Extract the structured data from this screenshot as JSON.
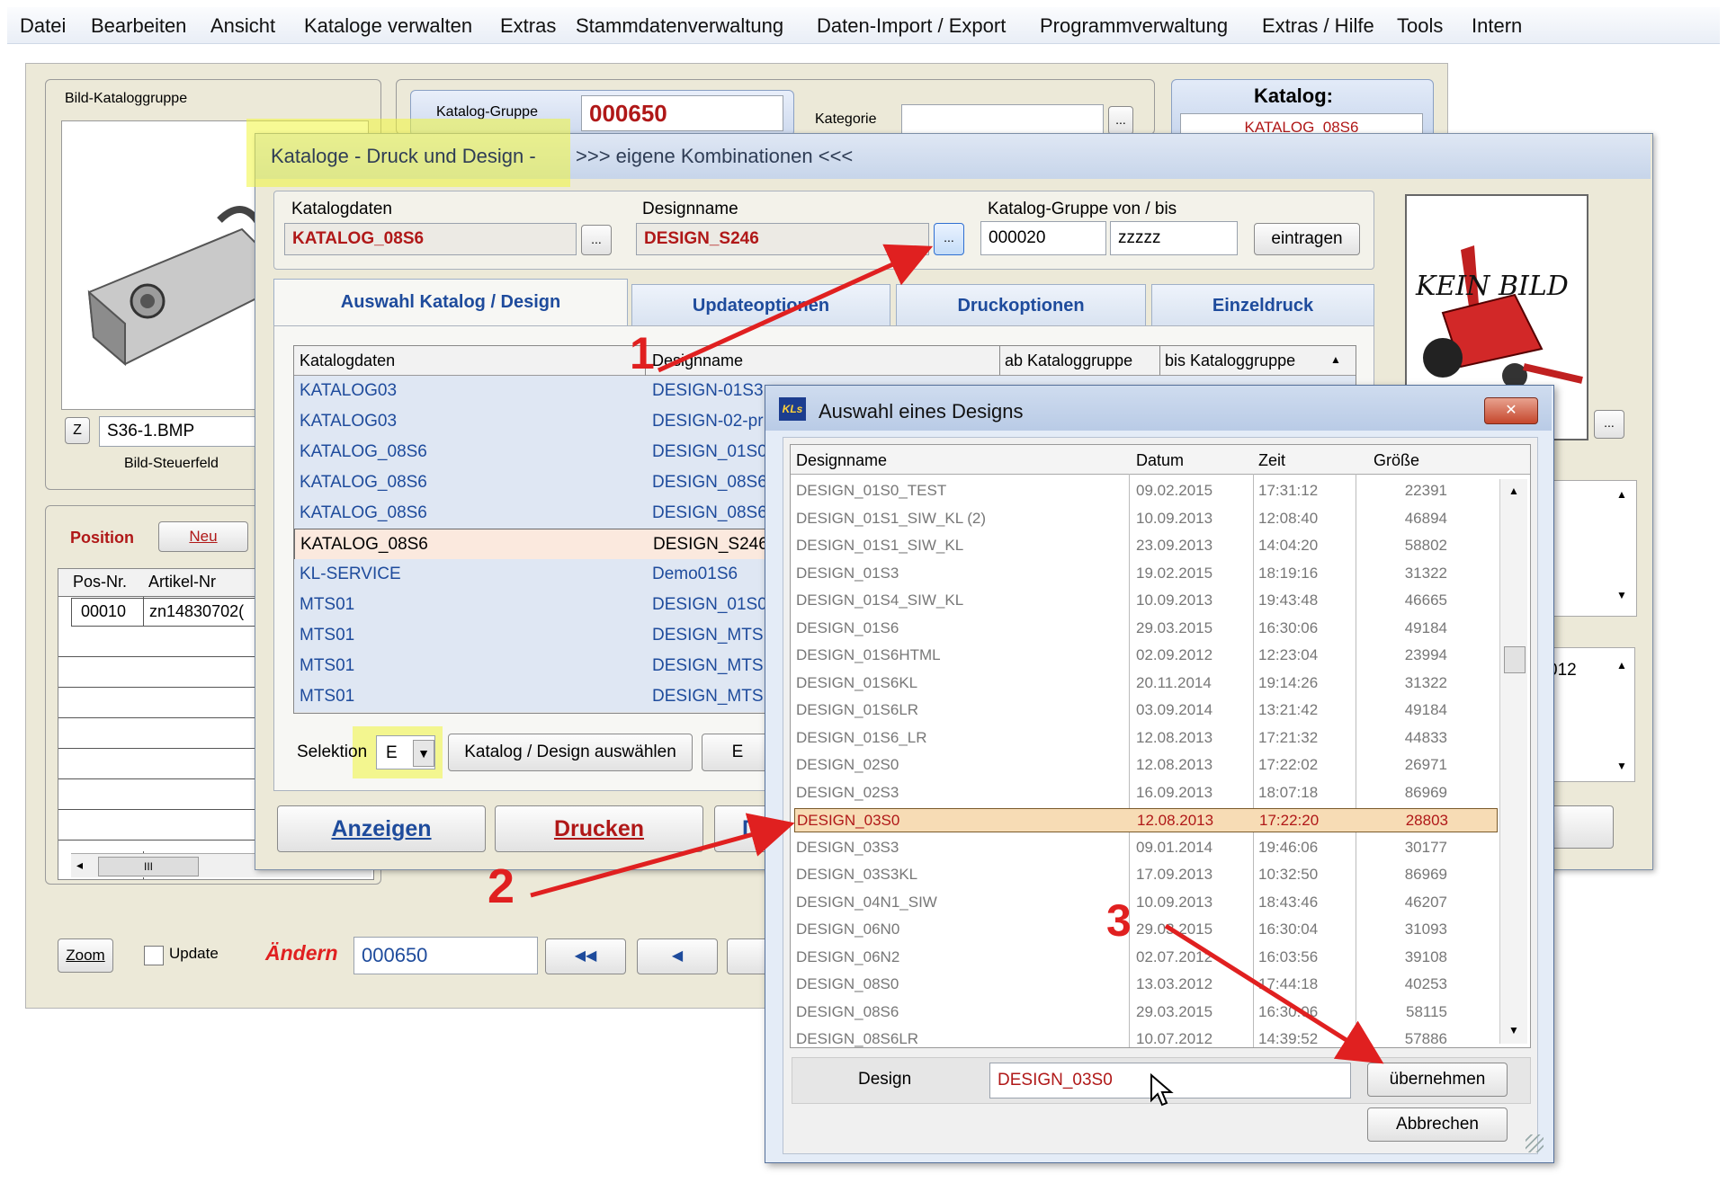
{
  "menu": [
    "Datei",
    "Bearbeiten",
    "Ansicht",
    "Kataloge verwalten",
    "Extras",
    "Stammdatenverwaltung",
    "Daten-Import / Export",
    "Programmverwaltung",
    "Extras / Hilfe",
    "Tools",
    "Intern"
  ],
  "back": {
    "bild_group_label": "Bild-Kataloggruppe",
    "katalog_gruppe_label": "Katalog-Gruppe",
    "katalog_gruppe_value": "000650",
    "kategorie_label": "Kategorie",
    "katalog_label": "Katalog:",
    "katalog_value": "KATALOG_08S6",
    "z_label": "Z",
    "bmp_value": "S36-1.BMP",
    "bild_steuerfeld": "Bild-Steuerfeld",
    "position_label": "Position",
    "neu_label": "Neu",
    "col_posnr": "Pos-Nr.",
    "col_artikel": "Artikel-Nr",
    "row_pos": "00010",
    "row_artikel": "zn14830702(",
    "zoom_label": "Zoom",
    "update_label": "Update",
    "aendern_label": "Ändern",
    "aendern_value": "000650",
    "side_value": "012",
    "keinbild": "KEIN BILD",
    "hscroll_mid": "III"
  },
  "main": {
    "title_a": "Kataloge - Druck und Design -",
    "title_b": ">>> eigene Kombinationen <<<",
    "katalogdaten_label": "Katalogdaten",
    "katalogdaten_value": "KATALOG_08S6",
    "designname_label": "Designname",
    "designname_value": "DESIGN_S246",
    "gruppe_label": "Katalog-Gruppe von / bis",
    "gruppe_von": "000020",
    "gruppe_bis": "zzzzz",
    "eintragen": "eintragen",
    "ellipsis": "...",
    "tabs": [
      "Auswahl Katalog / Design",
      "Updateoptionen",
      "Druckoptionen",
      "Einzeldruck"
    ],
    "table_headers": [
      "Katalogdaten",
      "Designname",
      "ab Kataloggruppe",
      "bis Kataloggruppe"
    ],
    "rows": [
      [
        "KATALOG03",
        "DESIGN-01S3"
      ],
      [
        "KATALOG03",
        "DESIGN-02-pr"
      ],
      [
        "KATALOG_08S6",
        "DESIGN_01S0"
      ],
      [
        "KATALOG_08S6",
        "DESIGN_08S6"
      ],
      [
        "KATALOG_08S6",
        "DESIGN_08S6"
      ],
      [
        "KATALOG_08S6",
        "DESIGN_S246"
      ],
      [
        "KL-SERVICE",
        "Demo01S6"
      ],
      [
        "MTS01",
        "DESIGN_01S0"
      ],
      [
        "MTS01",
        "DESIGN_MTS"
      ],
      [
        "MTS01",
        "DESIGN_MTS"
      ],
      [
        "MTS01",
        "DESIGN_MTS"
      ]
    ],
    "selektion_label": "Selektion",
    "selektion_value": "E",
    "auswaehlen": "Katalog / Design auswählen",
    "btn_e": "E",
    "anzeigen": "Anzeigen",
    "drucken": "Drucken",
    "btn_d": "D"
  },
  "dialog": {
    "title": "Auswahl eines Designs",
    "logo": "KLs",
    "headers": [
      "Designname",
      "Datum",
      "Zeit",
      "Größe"
    ],
    "rows": [
      [
        "DESIGN_01S0_TEST",
        "09.02.2015",
        "17:31:12",
        "22391"
      ],
      [
        "DESIGN_01S1_SIW_KL (2)",
        "10.09.2013",
        "12:08:40",
        "46894"
      ],
      [
        "DESIGN_01S1_SIW_KL",
        "23.09.2013",
        "14:04:20",
        "58802"
      ],
      [
        "DESIGN_01S3",
        "19.02.2015",
        "18:19:16",
        "31322"
      ],
      [
        "DESIGN_01S4_SIW_KL",
        "10.09.2013",
        "19:43:48",
        "46665"
      ],
      [
        "DESIGN_01S6",
        "29.03.2015",
        "16:30:06",
        "49184"
      ],
      [
        "DESIGN_01S6HTML",
        "02.09.2012",
        "12:23:04",
        "23994"
      ],
      [
        "DESIGN_01S6KL",
        "20.11.2014",
        "19:14:26",
        "31322"
      ],
      [
        "DESIGN_01S6LR",
        "03.09.2014",
        "13:21:42",
        "49184"
      ],
      [
        "DESIGN_01S6_LR",
        "12.08.2013",
        "17:21:32",
        "44833"
      ],
      [
        "DESIGN_02S0",
        "12.08.2013",
        "17:22:02",
        "26971"
      ],
      [
        "DESIGN_02S3",
        "16.09.2013",
        "18:07:18",
        "86969"
      ],
      [
        "DESIGN_03S0",
        "12.08.2013",
        "17:22:20",
        "28803"
      ],
      [
        "DESIGN_03S3",
        "09.01.2014",
        "19:46:06",
        "30177"
      ],
      [
        "DESIGN_03S3KL",
        "17.09.2013",
        "10:32:50",
        "86969"
      ],
      [
        "DESIGN_04N1_SIW",
        "10.09.2013",
        "18:43:46",
        "46207"
      ],
      [
        "DESIGN_06N0",
        "29.03.2015",
        "16:30:04",
        "31093"
      ],
      [
        "DESIGN_06N2",
        "02.07.2012",
        "16:03:56",
        "39108"
      ],
      [
        "DESIGN_08S0",
        "13.03.2012",
        "17:44:18",
        "40253"
      ],
      [
        "DESIGN_08S6",
        "29.03.2015",
        "16:30:06",
        "58115"
      ],
      [
        "DESIGN_08S6LR",
        "10.07.2012",
        "14:39:52",
        "57886"
      ]
    ],
    "selected_index": 12,
    "design_label": "Design",
    "design_value": "DESIGN_03S0",
    "uebernehmen": "übernehmen",
    "abbrechen": "Abbrechen",
    "close": "✕"
  },
  "annotations": [
    "1",
    "2",
    "3"
  ],
  "colors": {
    "annotation": "#e02020",
    "highlight": "#f0f53c",
    "title_red": "#b01818",
    "link_blue": "#1e4b9c"
  }
}
